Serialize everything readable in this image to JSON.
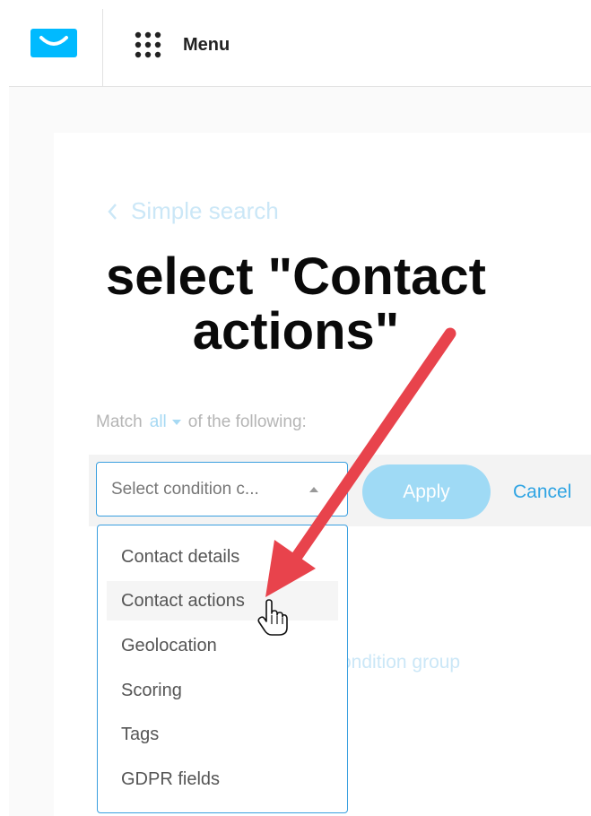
{
  "header": {
    "logo": "envelope-logo",
    "menu_label": "Menu",
    "menu_icon": "grid-icon"
  },
  "nav": {
    "back_label": "Simple search"
  },
  "annotation": {
    "line1": "select \"Contact",
    "line2": "actions\""
  },
  "match": {
    "prefix": "Match",
    "mode": "all",
    "suffix": "of the following:"
  },
  "condition": {
    "select_value": "Select condition c...",
    "apply_label": "Apply",
    "cancel_label": "Cancel",
    "hidden_link": "ondition group"
  },
  "dropdown": {
    "items": [
      "Contact details",
      "Contact actions",
      "Geolocation",
      "Scoring",
      "Tags",
      "GDPR fields"
    ],
    "hovered": "Contact actions"
  },
  "colors": {
    "accent": "#2fa4e3",
    "apply_button": "#9fdaf5",
    "arrow": "#e8434c",
    "logo": "#00baff"
  }
}
